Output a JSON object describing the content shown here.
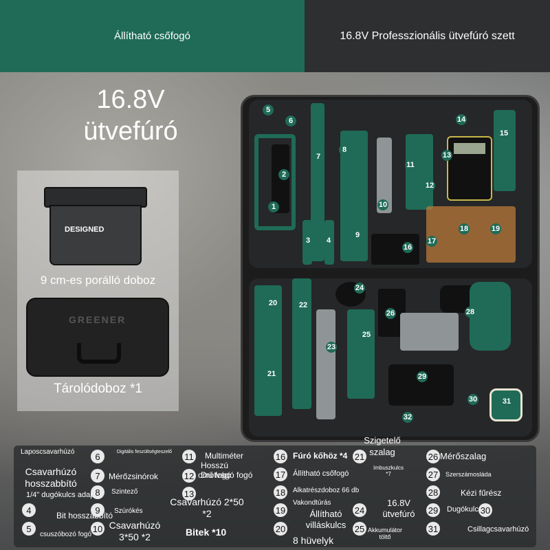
{
  "header": {
    "left_label": "Állítható csőfogó",
    "right_label": "16.8V Professzionális ütvefúró szett"
  },
  "headline": {
    "line1": "16.8V",
    "line2": "ütvefúró"
  },
  "side_items": {
    "dust_box_brand": "DESIGNED",
    "dust_box_label": "9 cm-es porálló doboz",
    "case_logo": "GREENER",
    "case_label": "Tárolódoboz *1"
  },
  "case_markers": [
    "1",
    "2",
    "3",
    "4",
    "5",
    "6",
    "7",
    "8",
    "9",
    "10",
    "11",
    "12",
    "13",
    "14",
    "15",
    "16",
    "17",
    "18",
    "19",
    "20",
    "21",
    "22",
    "23",
    "24",
    "25",
    "26",
    "28",
    "29",
    "30",
    "31",
    "32"
  ],
  "legend": {
    "col1": {
      "nums": [
        "4",
        "5"
      ],
      "items": [
        "Laposcsavarhúzó",
        "Csavarhúzó hosszabbító",
        "1/4\" dugókulcs adapter",
        "Bit hosszabbító",
        "csuszóbozó fogó"
      ]
    },
    "col2": {
      "nums": [
        "6",
        "7",
        "8",
        "9",
        "10"
      ],
      "items": [
        "Digitális feszültségteszelő",
        "Mérőzsinórok",
        "Szintező",
        "Szúrókés",
        "Csavarhúzó 3*50 *2"
      ]
    },
    "col3": {
      "nums": [
        "11",
        "12",
        "13"
      ],
      "items": [
        "Multiméter",
        "Hosszú orrú fogó",
        "Drótvágó fogó",
        "Csavarhúzó 2*50 *2",
        "Bitek *10"
      ]
    },
    "col4": {
      "nums": [
        "16",
        "17",
        "18",
        "19",
        "20"
      ],
      "items": [
        "Fúró kőhöz *4",
        "Állítható csőfogó",
        "Alkatrészdoboz 66 db",
        "Vakondtúrás",
        "Állítható villáskulcs",
        "8 hüvelyk"
      ]
    },
    "col5": {
      "nums": [
        "21",
        "24",
        "25"
      ],
      "items": [
        "Szigetelő szalag",
        "Imbuszkulcs *7",
        "16.8V ütvefúró",
        "Akkumulátor töltő"
      ]
    },
    "col6": {
      "nums": [
        "26",
        "27",
        "28",
        "29",
        "30",
        "31"
      ],
      "items": [
        "Mérőszalag",
        "Szerszámosláda",
        "Kézi fűrész",
        "Dugókulcs 9",
        "Csillagcsavarhúzó"
      ]
    }
  }
}
